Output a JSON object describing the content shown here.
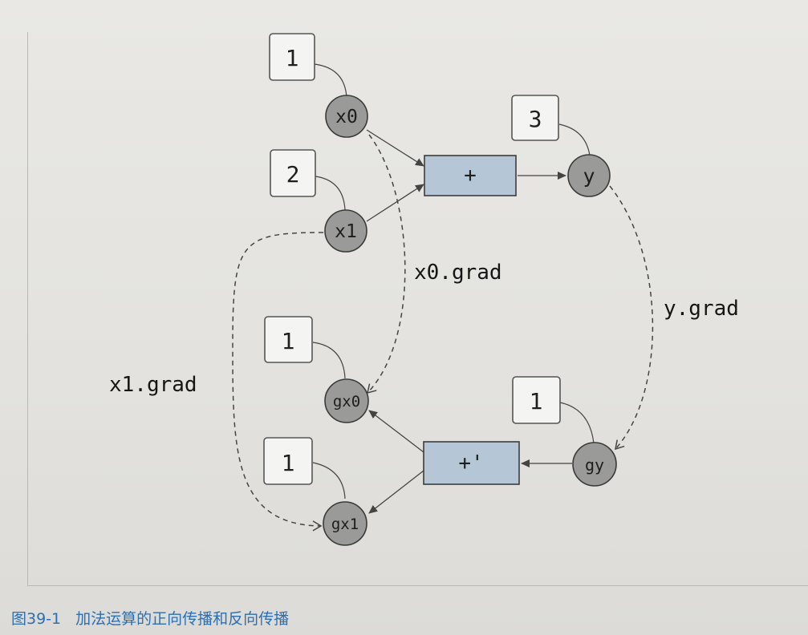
{
  "variables": {
    "x0_value": "1",
    "x1_value": "2",
    "y_value": "3",
    "gx0_value": "1",
    "gx1_value": "1",
    "gy_value": "1"
  },
  "nodes": {
    "x0": "x0",
    "x1": "x1",
    "y": "y",
    "gx0": "gx0",
    "gx1": "gx1",
    "gy": "gy"
  },
  "functions": {
    "add": "+",
    "add_grad": "+'"
  },
  "edge_labels": {
    "x0_grad": "x0.grad",
    "x1_grad": "x1.grad",
    "y_grad": "y.grad"
  },
  "caption": {
    "number": "图39-1",
    "text": "加法运算的正向传播和反向传播"
  },
  "colors": {
    "node_fill": "#9a9a98",
    "box_fill": "#b5c7d6",
    "value_box_fill": "#f4f4f2",
    "caption": "#2d6fb0"
  }
}
